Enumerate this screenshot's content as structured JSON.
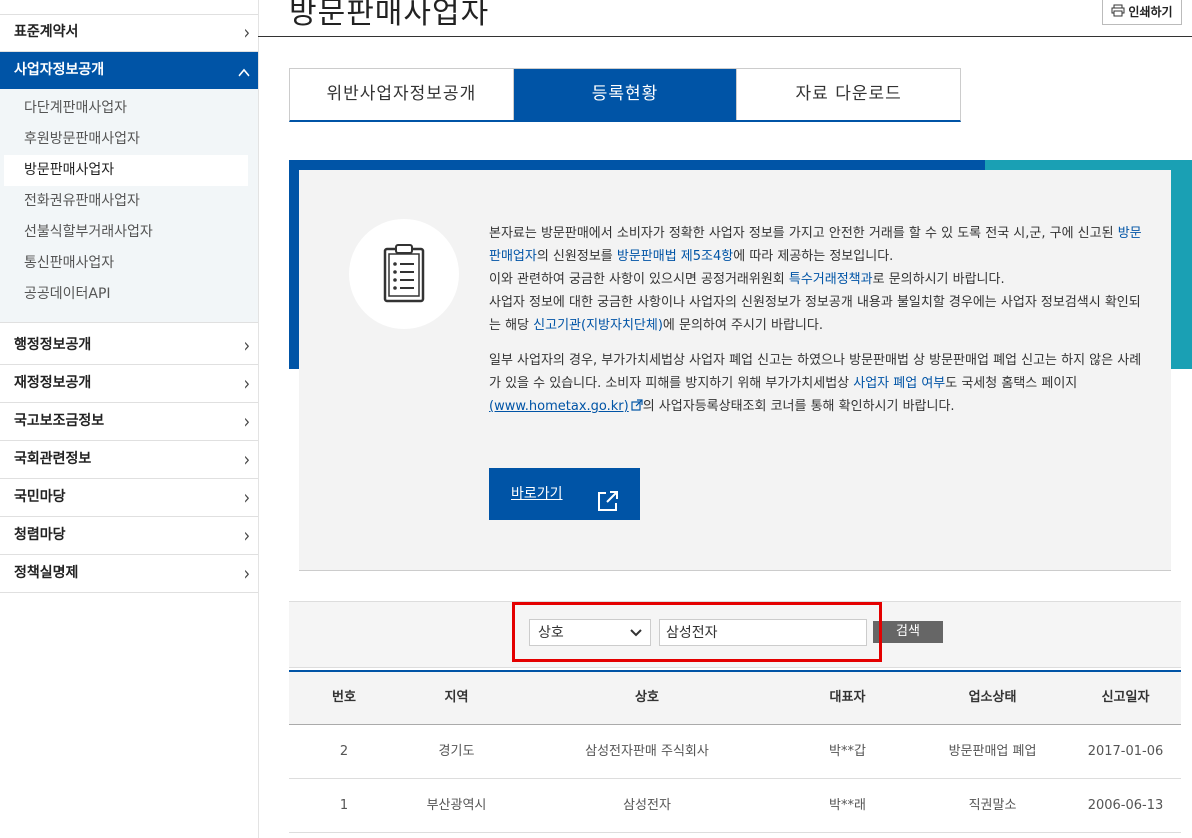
{
  "page": {
    "title": "방문판매사업자",
    "print_label": "인쇄하기"
  },
  "sidebar": {
    "items_top": [
      {
        "label": "표준계약서"
      }
    ],
    "active": {
      "label": "사업자정보공개"
    },
    "sub_items": [
      {
        "label": "다단계판매사업자"
      },
      {
        "label": "후원방문판매사업자"
      },
      {
        "label": "방문판매사업자"
      },
      {
        "label": "전화권유판매사업자"
      },
      {
        "label": "선불식할부거래사업자"
      },
      {
        "label": "통신판매사업자"
      },
      {
        "label": "공공데이터API"
      }
    ],
    "items_bottom": [
      {
        "label": "행정정보공개"
      },
      {
        "label": "재정정보공개"
      },
      {
        "label": "국고보조금정보"
      },
      {
        "label": "국회관련정보"
      },
      {
        "label": "국민마당"
      },
      {
        "label": "청렴마당"
      },
      {
        "label": "정책실명제"
      }
    ]
  },
  "tabs": [
    {
      "label": "위반사업자정보공개"
    },
    {
      "label": "등록현황"
    },
    {
      "label": "자료 다운로드"
    }
  ],
  "info": {
    "p1_a": "본자료는 방문판매에서 소비자가 정확한 사업자 정보를 가지고 안전한 거래를 할 수 있 도록 전국 시,군, 구에 신고된 ",
    "p1_hl1": "방문판매업자",
    "p1_b": "의 신원정보를 ",
    "p1_hl2": "방문판매법 제5조4항",
    "p1_c": "에 따라 제공하는 정보입니다.",
    "p1_d": "이와 관련하여 궁금한 사항이 있으시면 공정거래위원회 ",
    "p1_hl3": "특수거래정책과",
    "p1_e": "로 문의하시기 바랍니다.",
    "p1_f": "사업자 정보에 대한 궁금한 사항이나 사업자의 신원정보가 정보공개 내용과 불일치할 경우에는 사업자 정보검색시 확인되는 해당 ",
    "p1_hl4": "신고기관(지방자치단체)",
    "p1_g": "에 문의하여 주시기 바랍니다.",
    "p2_a": "일부 사업자의 경우, 부가가치세법상 사업자 폐업 신고는 하였으나 방문판매법 상 방문판매업 폐업 신고는 하지 않은 사례가 있을 수 있습니다. 소비자 피해를 방지하기 위해 부가가치세법상 ",
    "p2_hl1": "사업자 폐업 여부",
    "p2_b": "도 국세청 홈택스 페이지 ",
    "p2_link": "(www.hometax.go.kr)",
    "p2_c": "의 사업자등록상태조회 코너를 통해 확인하시기 바랍니다.",
    "go_label": "바로가기"
  },
  "search": {
    "select_value": "상호",
    "input_value": "삼성전자",
    "button_label": "검색"
  },
  "table": {
    "headers": [
      "번호",
      "지역",
      "상호",
      "대표자",
      "업소상태",
      "신고일자"
    ],
    "rows": [
      [
        "2",
        "경기도",
        "삼성전자판매 주식회사",
        "박**갑",
        "방문판매업 폐업",
        "2017-01-06"
      ],
      [
        "1",
        "부산광역시",
        "삼성전자",
        "박**래",
        "직권말소",
        "2006-06-13"
      ]
    ]
  },
  "colors": {
    "primary": "#0054a6",
    "teal": "#1aa0b4",
    "highlight_outline": "#e40000"
  }
}
